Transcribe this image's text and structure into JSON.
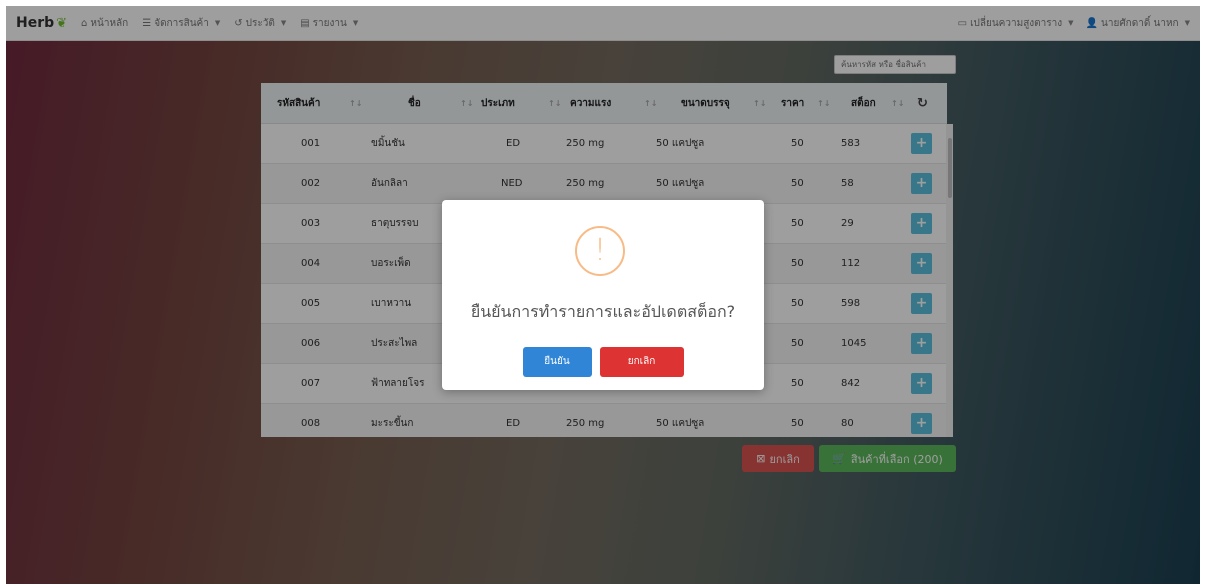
{
  "navbar": {
    "brand": "Herb",
    "items": [
      {
        "icon": "home-icon",
        "label": "หน้าหลัก"
      },
      {
        "icon": "list-icon",
        "label": "จัดการสินค้า"
      },
      {
        "icon": "history-icon",
        "label": "ประวัติ"
      },
      {
        "icon": "report-icon",
        "label": "รายงาน"
      }
    ],
    "right": [
      {
        "icon": "table-icon",
        "label": "เปลี่ยนความสูงตาราง"
      },
      {
        "icon": "user-icon",
        "label": "นายศักดาดิ์ นาหก"
      }
    ]
  },
  "search": {
    "placeholder": "ค้นหารหัส หรือ ชื่อสินค้า"
  },
  "table": {
    "headers": [
      "รหัสสินค้า",
      "ชื่อ",
      "ประเภท",
      "ความแรง",
      "ขนาดบรรจุ",
      "ราคา",
      "สต็อก"
    ],
    "rows": [
      {
        "code": "001",
        "name": "ขมิ้นชัน",
        "type": "ED",
        "strength": "250 mg",
        "pack": "50 แคปซูล",
        "price": "50",
        "stock": "583"
      },
      {
        "code": "002",
        "name": "อันกลิลา",
        "type": "NED",
        "strength": "250 mg",
        "pack": "50 แคปซูล",
        "price": "50",
        "stock": "58"
      },
      {
        "code": "003",
        "name": "ธาตุบรรจบ",
        "type": "",
        "strength": "",
        "pack": "",
        "price": "50",
        "stock": "29"
      },
      {
        "code": "004",
        "name": "บอระเพ็ด",
        "type": "",
        "strength": "",
        "pack": "",
        "price": "50",
        "stock": "112"
      },
      {
        "code": "005",
        "name": "เบาหวาน",
        "type": "",
        "strength": "",
        "pack": "",
        "price": "50",
        "stock": "598"
      },
      {
        "code": "006",
        "name": "ประสะไพล",
        "type": "",
        "strength": "",
        "pack": "",
        "price": "50",
        "stock": "1045"
      },
      {
        "code": "007",
        "name": "ฟ้าทลายโจร",
        "type": "",
        "strength": "",
        "pack": "",
        "price": "50",
        "stock": "842"
      },
      {
        "code": "008",
        "name": "มะระขี้นก",
        "type": "ED",
        "strength": "250 mg",
        "pack": "50 แคปซูล",
        "price": "50",
        "stock": "80"
      }
    ]
  },
  "buttons": {
    "cancel": "ยกเลิก",
    "cart": "สินค้าที่เลือก (200)"
  },
  "modal": {
    "icon": "!",
    "title": "ยืนยันการทำรายการและอัปเดตสต็อก?",
    "confirm": "ยืนยัน",
    "cancel": "ยกเลิก"
  },
  "colors": {
    "info": "#5bc0de",
    "danger": "#d9534f",
    "success": "#5cb85c",
    "confirm": "#3085d6",
    "modal_cancel": "#dd3333",
    "warning": "#f8bb86"
  }
}
